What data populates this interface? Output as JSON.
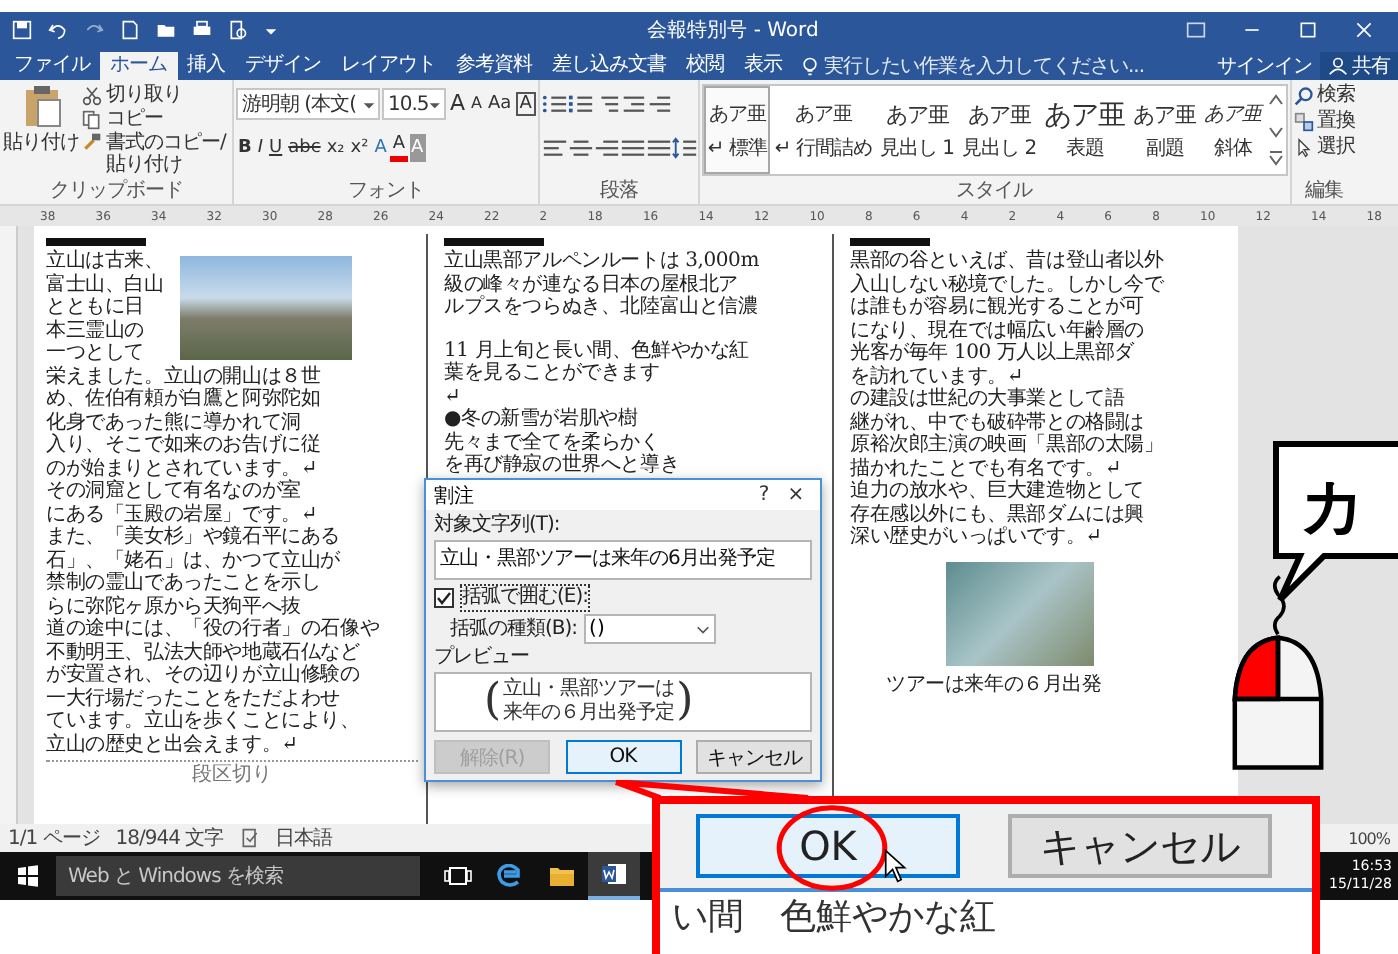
{
  "window": {
    "title": "会報特別号 - Word"
  },
  "ribbon_tabs": [
    {
      "label": "ファイル",
      "selected": false
    },
    {
      "label": "ホーム",
      "selected": true
    },
    {
      "label": "挿入",
      "selected": false
    },
    {
      "label": "デザイン",
      "selected": false
    },
    {
      "label": "レイアウト",
      "selected": false
    },
    {
      "label": "参考資料",
      "selected": false
    },
    {
      "label": "差し込み文書",
      "selected": false
    },
    {
      "label": "校閲",
      "selected": false
    },
    {
      "label": "表示",
      "selected": false
    }
  ],
  "tell_me": {
    "placeholder": "実行したい作業を入力してください..."
  },
  "account": {
    "sign_in": "サインイン",
    "share": "共有"
  },
  "clipboard": {
    "paste": "貼り付け",
    "cut": "切り取り",
    "copy": "コピー",
    "format_painter": "書式のコピー/貼り付け",
    "label": "クリップボード"
  },
  "font": {
    "name": "游明朝 (本文(",
    "size": "10.5",
    "label": "フォント",
    "row1_buttons": [
      {
        "label": "A",
        "kind": "grow"
      },
      {
        "label": "A",
        "kind": "shrink"
      },
      {
        "label": "Aa",
        "kind": "case"
      },
      {
        "label": "A",
        "kind": "border"
      }
    ],
    "row2_buttons": [
      {
        "label": "B",
        "kind": "bold"
      },
      {
        "label": "I",
        "kind": "italic"
      },
      {
        "label": "U",
        "kind": "underline"
      },
      {
        "label": "abc",
        "kind": "strike"
      },
      {
        "label": "x₂",
        "kind": "sub"
      },
      {
        "label": "x²",
        "kind": "sup"
      },
      {
        "label": "A",
        "kind": "effects"
      },
      {
        "label": "A",
        "kind": "color"
      },
      {
        "label": "A",
        "kind": "shading"
      }
    ]
  },
  "paragraph": {
    "label": "段落"
  },
  "styles": {
    "label": "スタイル",
    "items": [
      {
        "preview": "あア亜",
        "name": "↵ 標準",
        "kind": "normal",
        "selected": true
      },
      {
        "preview": "あア亜",
        "name": "↵ 行間詰め",
        "kind": "normal",
        "selected": false
      },
      {
        "preview": "あア亜",
        "name": "見出し 1",
        "kind": "heading",
        "selected": false
      },
      {
        "preview": "あア亜",
        "name": "見出し 2",
        "kind": "heading",
        "selected": false
      },
      {
        "preview": "あア亜",
        "name": "表題",
        "kind": "title",
        "selected": false
      },
      {
        "preview": "あア亜",
        "name": "副題",
        "kind": "heading",
        "selected": false
      },
      {
        "preview": "あア亜",
        "name": "斜体",
        "kind": "emphasis",
        "selected": false
      }
    ]
  },
  "editing": {
    "find": "検索",
    "replace": "置換",
    "select": "選択",
    "label": "編集"
  },
  "ruler_numbers": [
    "38",
    "36",
    "34",
    "32",
    "30",
    "28",
    "26",
    "24",
    "22",
    "2",
    "18",
    "16",
    "14",
    "12",
    "10",
    "8",
    "6",
    "4",
    "2",
    "4",
    "6",
    "8",
    "10",
    "12",
    "14",
    "18"
  ],
  "document": {
    "column_1": {
      "beside_photo": [
        "立山は古来、",
        "富士山、白山",
        "とともに日",
        "本三霊山の",
        "一つとして"
      ],
      "lines": [
        "栄えました。立山の開山は８世",
        "め、佐伯有頼が白鷹と阿弥陀如",
        "化身であった熊に導かれて洞",
        "入り、そこで如来のお告げに従",
        "のが始まりとされています。↵",
        "その洞窟として有名なのが室",
        "にある「玉殿の岩屋」です。↵",
        "また、「美女杉」や鏡石平にある",
        "石」、「姥石」は、かつて立山が",
        "禁制の霊山であったことを示し",
        "らに弥陀ヶ原から天狗平へ抜",
        "道の途中には、「役の行者」の石像や",
        "不動明王、弘法大師や地蔵石仏など",
        "が安置され、その辺りが立山修験の",
        "一大行場だったことをただよわせ",
        "ています。立山を歩くことにより、",
        "立山の歴史と出会えます。↵"
      ],
      "section_break": "段区切り"
    },
    "column_2": {
      "lines_top": [
        "立山黒部アルペンルートは 3,000m",
        "級の峰々が連なる日本の屋根北ア",
        "ルプスをつらぬき、北陸富山と信濃"
      ],
      "lines": [
        "11 月上旬と長い間、色鮮やかな紅",
        "葉を見ることができます",
        "↵",
        "●冬の新雪が岩肌や樹",
        "先々まで全てを柔らかく",
        "を再び静寂の世界へと導き"
      ]
    },
    "column_3": {
      "lines": [
        "黒部の谷といえば、昔は登山者以外",
        "入山しない秘境でした。しかし今で",
        "は誰もが容易に観光することが可",
        "になり、現在では幅広い年齢層の",
        "光客が毎年 100 万人以上黒部ダ",
        "を訪れています。↵",
        "の建設は世紀の大事業として語",
        "継がれ、中でも破砕帯との格闘は",
        "原裕次郎主演の映画「黒部の太陽」",
        "描かれたことでも有名です。↵",
        "迫力の放水や、巨大建造物として",
        "存在感以外にも、黒部ダムには興",
        "深い歴史がいっぱいです。↵"
      ],
      "after_photo": "ツアーは来年の６月出発"
    }
  },
  "dialog": {
    "title": "割注",
    "help": "?",
    "close": "×",
    "target_label": "対象文字列(T):",
    "target_value": "立山・黒部ツアーは来年の6月出発予定",
    "enclose": {
      "label": "括弧で囲む(E):",
      "checked": true
    },
    "bracket_label": "括弧の種類(B):",
    "bracket_value": "()",
    "preview_label": "プレビュー",
    "preview_open": "(",
    "preview_lines": [
      "立山・黒部ツアーは",
      "来年の６月出発予定"
    ],
    "preview_close": ")",
    "buttons": [
      {
        "label": "解除(R)",
        "disabled": true,
        "selected": false
      },
      {
        "label": "OK",
        "disabled": false,
        "selected": true
      },
      {
        "label": "キャンセル",
        "disabled": false,
        "selected": false
      }
    ]
  },
  "status_bar": {
    "page": "1/1 ページ",
    "words": "18/944 文字",
    "language": "日本語",
    "zoom": "100%"
  },
  "taskbar": {
    "search": {
      "placeholder": "Web と Windows を検索"
    },
    "apps": [
      {
        "kind": "task-view",
        "selected": false
      },
      {
        "kind": "browser",
        "selected": false
      },
      {
        "kind": "folder",
        "selected": false
      },
      {
        "kind": "word",
        "selected": true
      }
    ],
    "time": "16:53",
    "date": "15/11/28"
  },
  "callout": {
    "buttons": [
      {
        "label": "OK",
        "selected": true
      },
      {
        "label": "キャンセル",
        "selected": false
      }
    ],
    "text_below": "い間　色鮮やかな紅",
    "bubble": "カ"
  }
}
